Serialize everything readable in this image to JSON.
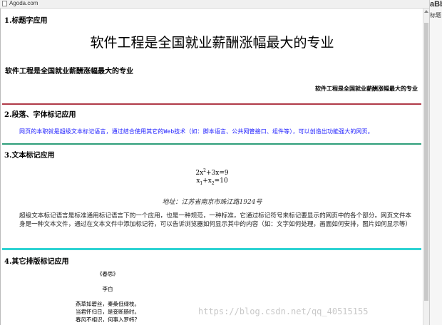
{
  "window": {
    "tab_title": "Agoda.com"
  },
  "side_panel": {
    "style_preview": "aBb",
    "style_label": "标题"
  },
  "sections": {
    "s1": {
      "heading": "1.标题字应用",
      "h1": "软件工程是全国就业薪酬涨幅最大的专业",
      "h3": "软件工程是全国就业薪酬涨幅最大的专业",
      "h4_right": "软件工程是全国就业薪酬涨幅最大的专业"
    },
    "s2": {
      "heading": "2.段落、字体标记应用",
      "para": "网页的本职就是超级文本标记语言，通过结合使用其它的Web技术（如：脚本语言、公共网管接口、组件等），可以创造出功能强大的网页。"
    },
    "s3": {
      "heading": "3.文本标记应用",
      "formula1": {
        "base": "2x",
        "sup": "2",
        "rest": "+3x=9"
      },
      "formula2": {
        "a": "x",
        "a_sub": "1",
        "plus": "+x",
        "b_sub": "2",
        "rest": "=10"
      },
      "address": "地址：江苏省南京市珠江路1924号",
      "para": "超级文本标记语言是标准通用标记语言下的一个应用，也是一种规范，一种标准，它通过标记符号来标记要显示的网页中的各个部分。网页文件本身是一种文本文件，通过在文本文件中添加标记符，可以告诉浏览器如何显示其中的内容（如：文字如何处理，画面如何安排，图片如何显示等）"
    },
    "s4": {
      "heading": "4.其它排版标记应用",
      "poem_title": "《春思》",
      "poem_author": "李白",
      "poem_lines": [
        "燕草如碧丝，秦桑低绿枝。",
        "当君怀归日，是妾断肠时。",
        "春风不相识，何事入罗帏？"
      ]
    }
  },
  "colors": {
    "hr1": "#b03a48",
    "hr2": "#2e9e7a",
    "hr3": "#2ed3d3",
    "blue_text": "#1a1aff"
  },
  "watermark": "https://blog.csdn.net/qq_40515155"
}
